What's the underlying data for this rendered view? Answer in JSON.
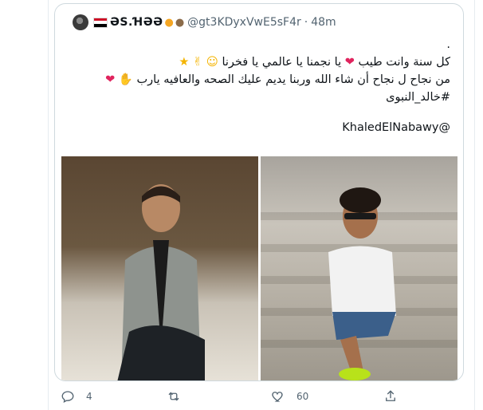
{
  "quoted_tweet": {
    "display_name": "ƏS.ꞪƏƏ",
    "handle": "@gt3KDyxVwE5sF4r",
    "separator": "·",
    "time": "48m",
    "lines": [
      ".",
      "كل سنة وانت طيب",
      "يا نجمنا يا عالمي يا فخرنا",
      "من نجاح ل نجاح أن شاء الله وربنا يديم عليك الصحه والعافيه يارب",
      "#خالد_النبوى",
      "@KhaledElNabawy"
    ],
    "icons": [
      "egypt-flag-icon",
      "chick-icon",
      "sloth-icon",
      "heart-icon",
      "smile-icon",
      "hand-icon",
      "star-eyes-icon"
    ]
  },
  "media": [
    {
      "name": "photo-suit",
      "alt": "man in grey suit seated"
    },
    {
      "name": "photo-stairs",
      "alt": "man in white t-shirt on stairs"
    }
  ],
  "actions": {
    "reply_count": "4",
    "retweet_count": "",
    "like_count": "60"
  },
  "colors": {
    "text": "#0f1419",
    "muted": "#536471",
    "border": "#cfd9de",
    "heart": "#e0245e"
  }
}
